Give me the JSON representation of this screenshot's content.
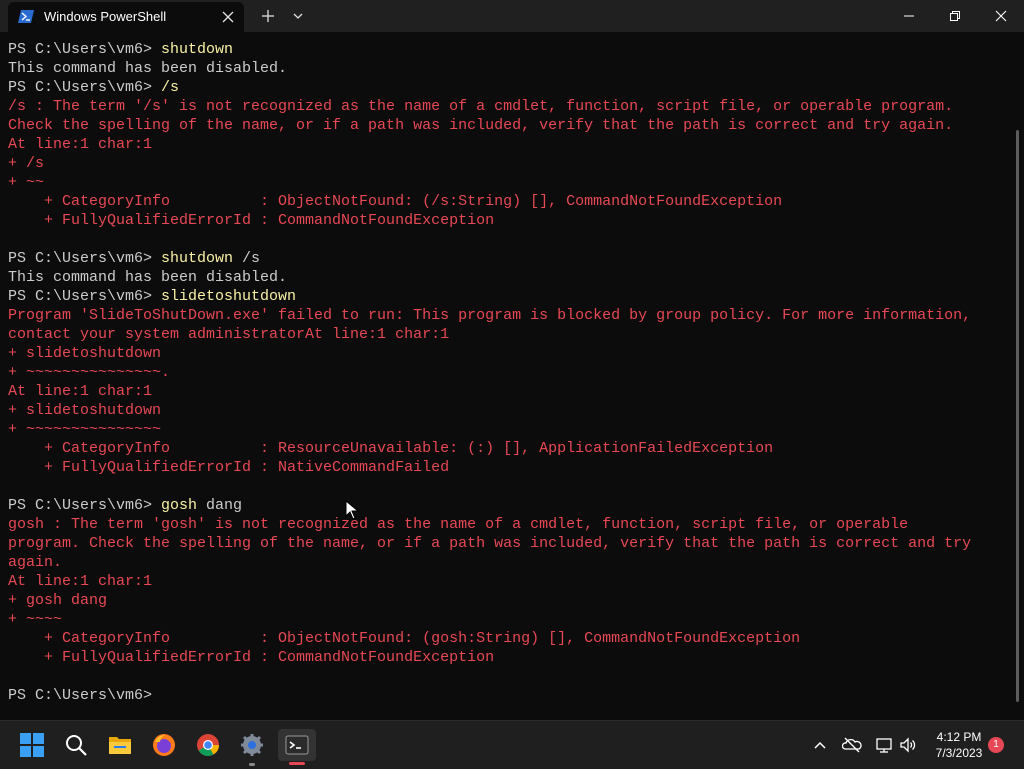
{
  "window": {
    "tab_title": "Windows PowerShell",
    "tab_icon": "powershell-icon"
  },
  "console": {
    "lines": [
      [
        {
          "t": "PS C:\\Users\\vm6> ",
          "c": "prompt"
        },
        {
          "t": "shutdown",
          "c": "cmd"
        }
      ],
      [
        {
          "t": "This command has been disabled.",
          "c": "prompt"
        }
      ],
      [
        {
          "t": "PS C:\\Users\\vm6> ",
          "c": "prompt"
        },
        {
          "t": "/s",
          "c": "cmd"
        }
      ],
      [
        {
          "t": "/s : The term '/s' is not recognized as the name of a cmdlet, function, script file, or operable program.",
          "c": "err"
        }
      ],
      [
        {
          "t": "Check the spelling of the name, or if a path was included, verify that the path is correct and try again.",
          "c": "err"
        }
      ],
      [
        {
          "t": "At line:1 char:1",
          "c": "err"
        }
      ],
      [
        {
          "t": "+ /s",
          "c": "err"
        }
      ],
      [
        {
          "t": "+ ~~",
          "c": "err"
        }
      ],
      [
        {
          "t": "    + CategoryInfo          : ObjectNotFound: (/s:String) [], CommandNotFoundException",
          "c": "err"
        }
      ],
      [
        {
          "t": "    + FullyQualifiedErrorId : CommandNotFoundException",
          "c": "err"
        }
      ],
      [
        {
          "t": "",
          "c": "prompt"
        }
      ],
      [
        {
          "t": "PS C:\\Users\\vm6> ",
          "c": "prompt"
        },
        {
          "t": "shutdown",
          "c": "cmd"
        },
        {
          "t": " /s",
          "c": "arg"
        }
      ],
      [
        {
          "t": "This command has been disabled.",
          "c": "prompt"
        }
      ],
      [
        {
          "t": "PS C:\\Users\\vm6> ",
          "c": "prompt"
        },
        {
          "t": "slidetoshutdown",
          "c": "cmd"
        }
      ],
      [
        {
          "t": "Program 'SlideToShutDown.exe' failed to run: This program is blocked by group policy. For more information,",
          "c": "err"
        }
      ],
      [
        {
          "t": "contact your system administratorAt line:1 char:1",
          "c": "err"
        }
      ],
      [
        {
          "t": "+ slidetoshutdown",
          "c": "err"
        }
      ],
      [
        {
          "t": "+ ~~~~~~~~~~~~~~~.",
          "c": "err"
        }
      ],
      [
        {
          "t": "At line:1 char:1",
          "c": "err"
        }
      ],
      [
        {
          "t": "+ slidetoshutdown",
          "c": "err"
        }
      ],
      [
        {
          "t": "+ ~~~~~~~~~~~~~~~",
          "c": "err"
        }
      ],
      [
        {
          "t": "    + CategoryInfo          : ResourceUnavailable: (:) [], ApplicationFailedException",
          "c": "err"
        }
      ],
      [
        {
          "t": "    + FullyQualifiedErrorId : NativeCommandFailed",
          "c": "err"
        }
      ],
      [
        {
          "t": "",
          "c": "prompt"
        }
      ],
      [
        {
          "t": "PS C:\\Users\\vm6> ",
          "c": "prompt"
        },
        {
          "t": "gosh",
          "c": "cmd"
        },
        {
          "t": " dang",
          "c": "arg"
        }
      ],
      [
        {
          "t": "gosh : The term 'gosh' is not recognized as the name of a cmdlet, function, script file, or operable",
          "c": "err"
        }
      ],
      [
        {
          "t": "program. Check the spelling of the name, or if a path was included, verify that the path is correct and try",
          "c": "err"
        }
      ],
      [
        {
          "t": "again.",
          "c": "err"
        }
      ],
      [
        {
          "t": "At line:1 char:1",
          "c": "err"
        }
      ],
      [
        {
          "t": "+ gosh dang",
          "c": "err"
        }
      ],
      [
        {
          "t": "+ ~~~~",
          "c": "err"
        }
      ],
      [
        {
          "t": "    + CategoryInfo          : ObjectNotFound: (gosh:String) [], CommandNotFoundException",
          "c": "err"
        }
      ],
      [
        {
          "t": "    + FullyQualifiedErrorId : CommandNotFoundException",
          "c": "err"
        }
      ],
      [
        {
          "t": "",
          "c": "prompt"
        }
      ],
      [
        {
          "t": "PS C:\\Users\\vm6> ",
          "c": "prompt"
        }
      ]
    ]
  },
  "taskbar": {
    "icons": [
      "windows-start-icon",
      "search-icon",
      "file-explorer-icon",
      "firefox-icon",
      "chrome-icon",
      "settings-icon",
      "terminal-icon"
    ],
    "tray": {
      "time": "4:12 PM",
      "date": "7/3/2023",
      "notification_count": "1"
    }
  },
  "colors": {
    "console_bg": "#0c0c0c",
    "error_text": "#e74856",
    "command_text": "#f9f1a5",
    "default_text": "#cccccc",
    "accent": "#e74856"
  }
}
